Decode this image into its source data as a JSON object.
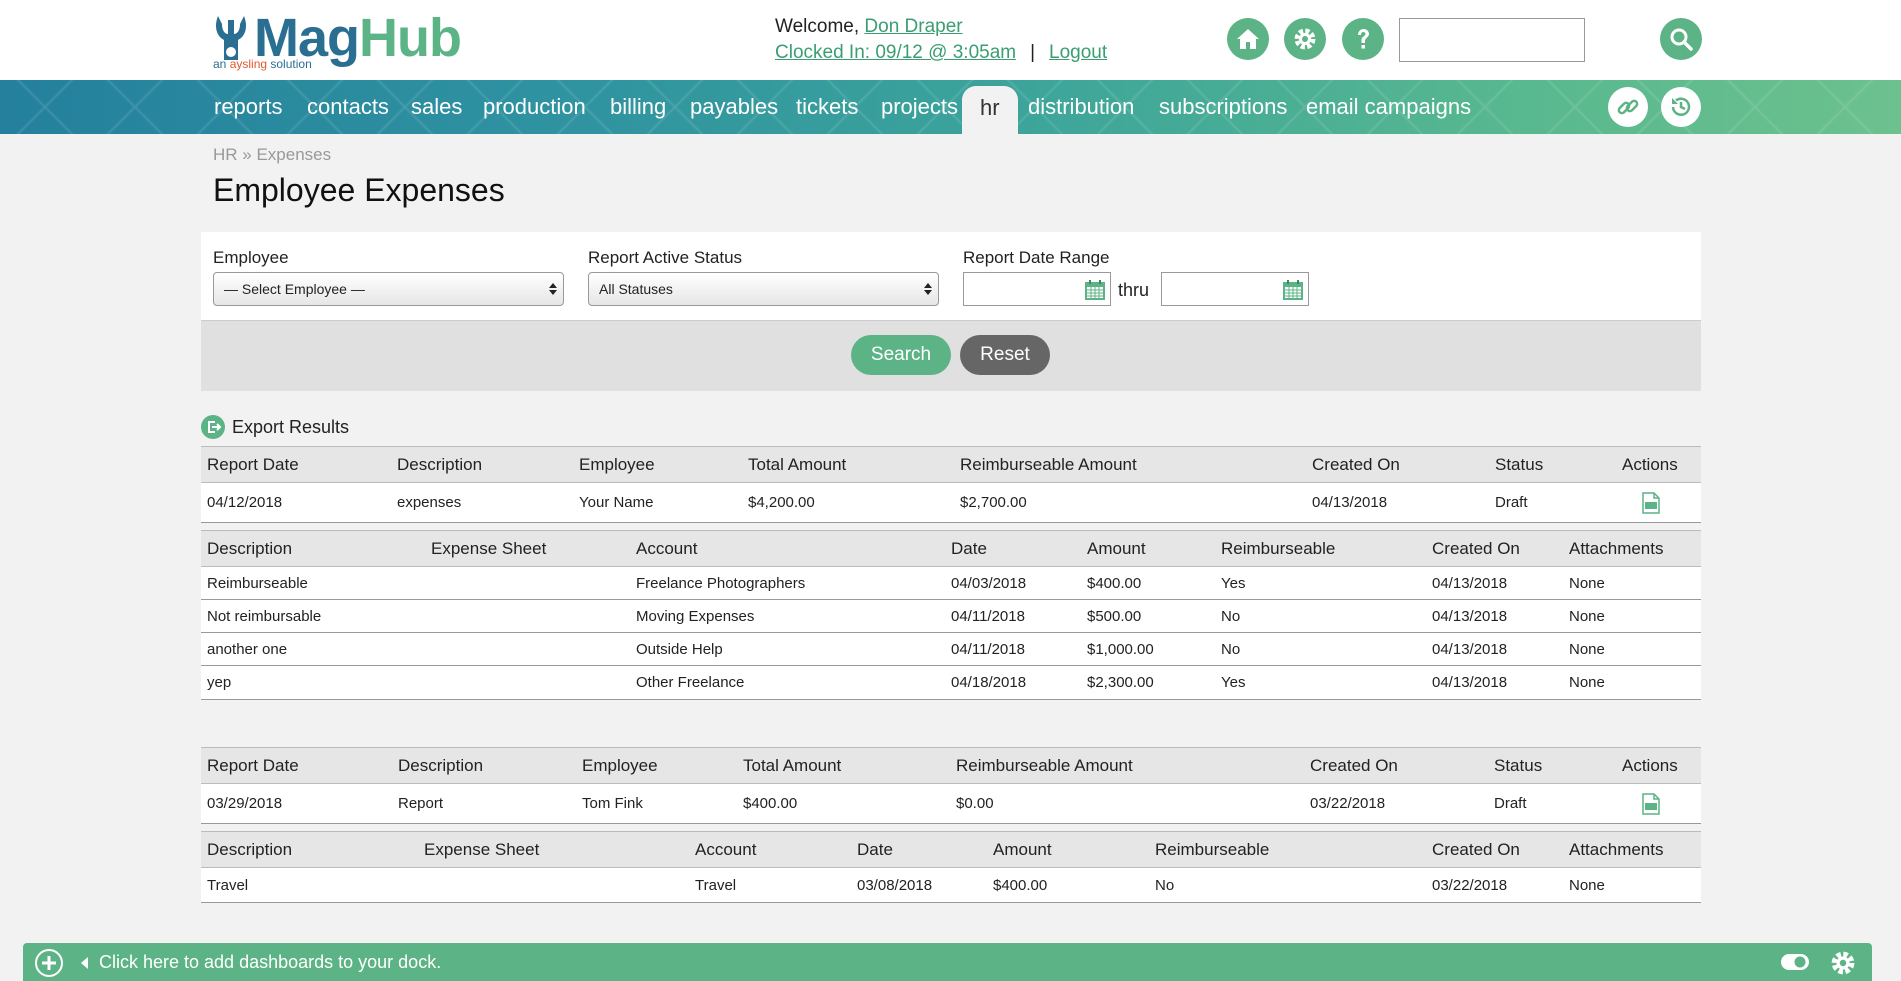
{
  "header": {
    "brand_mag": "Mag",
    "brand_hub": "Hub",
    "tagline_pre": "an ",
    "tagline_ays": "aysling",
    "tagline_post": " solution",
    "welcome_prefix": "Welcome, ",
    "user_name": "Don Draper",
    "clocked_in": "Clocked In: 09/12 @ 3:05am",
    "separator": "|",
    "logout": "Logout",
    "search_value": ""
  },
  "nav": {
    "items": [
      "reports",
      "contacts",
      "sales",
      "production",
      "billing",
      "payables",
      "tickets",
      "projects",
      "hr",
      "distribution",
      "subscriptions",
      "email campaigns"
    ],
    "active": "hr"
  },
  "breadcrumb": "HR » Expenses",
  "page_title": "Employee Expenses",
  "filters": {
    "employee_label": "Employee",
    "employee_value": "— Select Employee —",
    "status_label": "Report Active Status",
    "status_value": "All Statuses",
    "date_label": "Report Date Range",
    "date_from": "",
    "date_to": "",
    "thru": "thru",
    "search_button": "Search",
    "reset_button": "Reset"
  },
  "export_label": "Export Results",
  "report_headers": [
    "Report Date",
    "Description",
    "Employee",
    "Total Amount",
    "Reimburseable Amount",
    "Created On",
    "Status",
    "Actions"
  ],
  "detail_headers": [
    "Description",
    "Expense Sheet",
    "Account",
    "Date",
    "Amount",
    "Reimburseable",
    "Created On",
    "Attachments"
  ],
  "reports": [
    {
      "report_date": "04/12/2018",
      "description": "expenses",
      "employee": "Your Name",
      "total_amount": "$4,200.00",
      "reimburseable_amount": "$2,700.00",
      "created_on": "04/13/2018",
      "status": "Draft",
      "action_icon": "pdf-icon",
      "lines": [
        {
          "description": "Reimburseable",
          "expense_sheet": "",
          "account": "Freelance Photographers",
          "date": "04/03/2018",
          "amount": "$400.00",
          "reimburseable": "Yes",
          "created_on": "04/13/2018",
          "attachments": "None"
        },
        {
          "description": "Not reimbursable",
          "expense_sheet": "",
          "account": "Moving Expenses",
          "date": "04/11/2018",
          "amount": "$500.00",
          "reimburseable": "No",
          "created_on": "04/13/2018",
          "attachments": "None"
        },
        {
          "description": "another one",
          "expense_sheet": "",
          "account": "Outside Help",
          "date": "04/11/2018",
          "amount": "$1,000.00",
          "reimburseable": "No",
          "created_on": "04/13/2018",
          "attachments": "None"
        },
        {
          "description": "yep",
          "expense_sheet": "",
          "account": "Other Freelance",
          "date": "04/18/2018",
          "amount": "$2,300.00",
          "reimburseable": "Yes",
          "created_on": "04/13/2018",
          "attachments": "None"
        }
      ]
    },
    {
      "report_date": "03/29/2018",
      "description": "Report",
      "employee": "Tom Fink",
      "total_amount": "$400.00",
      "reimburseable_amount": "$0.00",
      "created_on": "03/22/2018",
      "status": "Draft",
      "action_icon": "pdf-icon",
      "lines": [
        {
          "description": "Travel",
          "expense_sheet": "",
          "account": "Travel",
          "date": "03/08/2018",
          "amount": "$400.00",
          "reimburseable": "No",
          "created_on": "03/22/2018",
          "attachments": "None"
        }
      ]
    }
  ],
  "dock": {
    "text": "Click here to add dashboards to your dock."
  },
  "colors": {
    "accent": "#5cb385",
    "brand_blue": "#2a6f91",
    "link": "#3a9e72"
  }
}
